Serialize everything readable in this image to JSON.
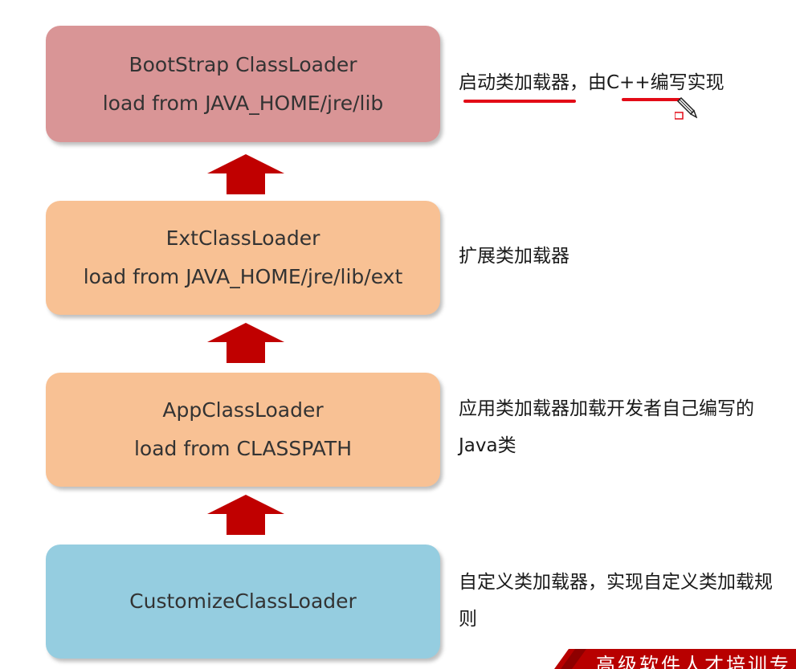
{
  "boxes": {
    "bootstrap": {
      "title": "BootStrap ClassLoader",
      "subtitle": "load from JAVA_HOME/jre/lib",
      "color": "#d99596"
    },
    "ext": {
      "title": "ExtClassLoader",
      "subtitle": "load from JAVA_HOME/jre/lib/ext",
      "color": "#f8c194"
    },
    "app": {
      "title": "AppClassLoader",
      "subtitle": "load from CLASSPATH",
      "color": "#f8c194"
    },
    "custom": {
      "title": "CustomizeClassLoader",
      "color": "#95cde0"
    }
  },
  "notes": {
    "bootstrap": "启动类加载器，由C++编写实现",
    "ext": "扩展类加载器",
    "app": "应用类加载器加载开发者自己编写的Java类",
    "custom": "自定义类加载器，实现自定义类加载规则"
  },
  "banner": {
    "text": "高级软件人才培训专"
  },
  "colors": {
    "arrow": "#c00000",
    "underline": "#e30b17",
    "banner": "#c00000"
  },
  "icons": {
    "cursor": "pen-cursor-icon",
    "arrow": "up-arrow-icon"
  }
}
